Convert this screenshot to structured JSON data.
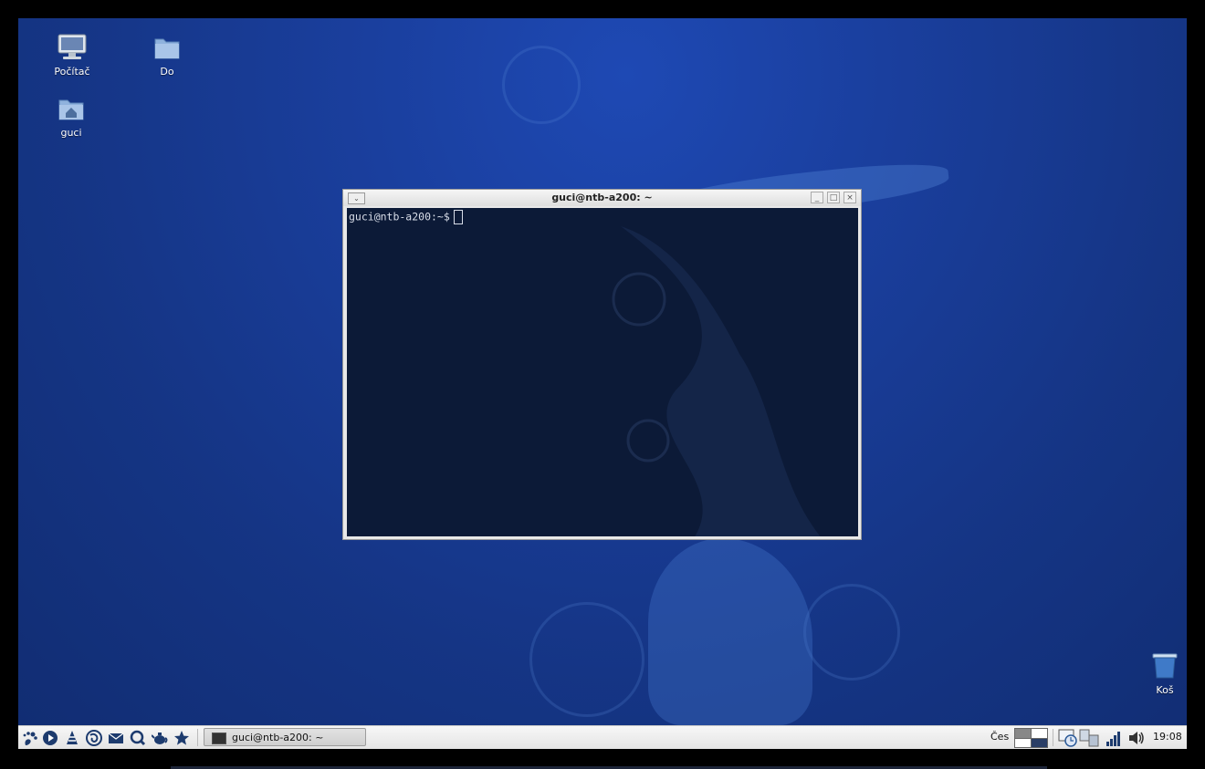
{
  "desktop": {
    "icons": [
      {
        "label": "Počítač",
        "icon": "computer-icon"
      },
      {
        "label": "Do",
        "icon": "folder-icon"
      },
      {
        "label": "guci",
        "icon": "home-folder-icon"
      },
      {
        "label": "Koš",
        "icon": "trash-icon"
      }
    ]
  },
  "terminal": {
    "title": "guci@ntb-a200: ~",
    "prompt": "guci@ntb-a200:~$"
  },
  "taskbar": {
    "launchers": [
      "gnome-foot-icon",
      "media-player-icon",
      "vlc-cone-icon",
      "firefox-icon",
      "mail-icon",
      "search-icon",
      "teapot-icon",
      "star-icon"
    ],
    "window_button": "guci@ntb-a200: ~",
    "keyboard_layout": "Čes",
    "clock": "19:08"
  },
  "colors": {
    "desktop_bg": "#1a3f9e",
    "terminal_bg": "#0c1a37",
    "panel_bg": "#ececec"
  }
}
